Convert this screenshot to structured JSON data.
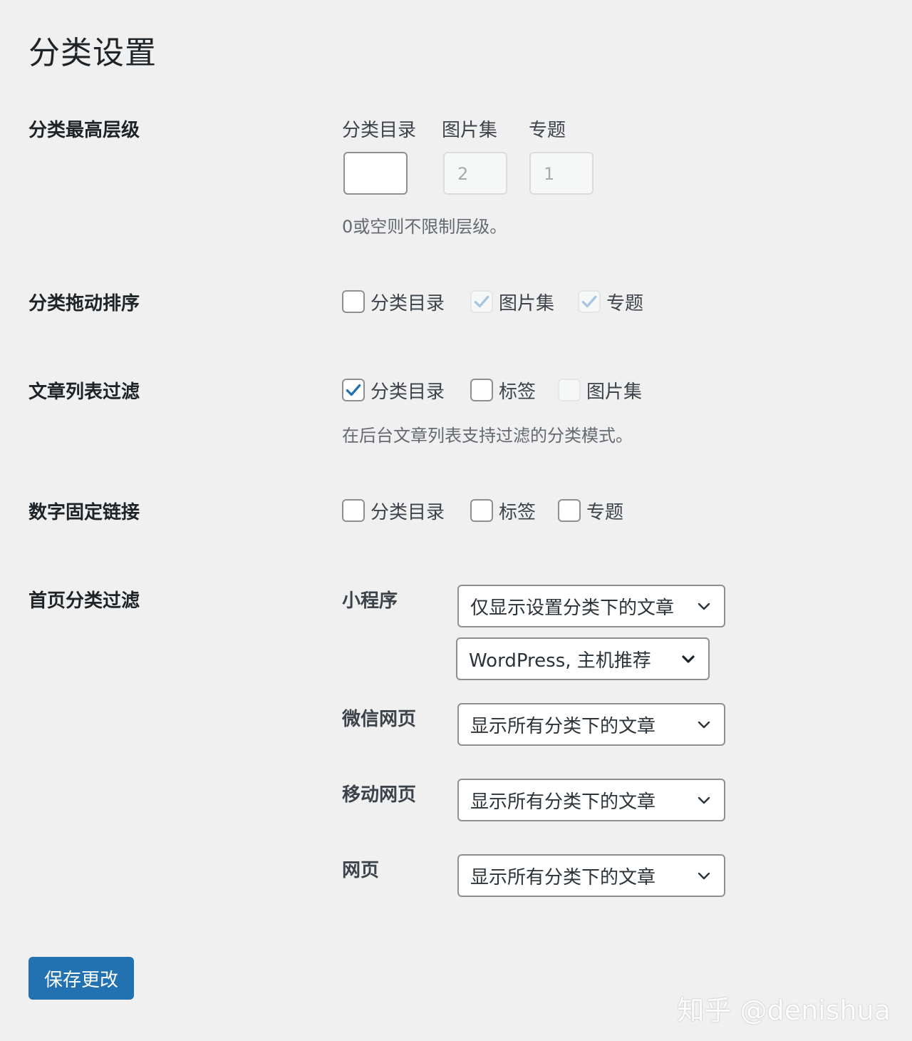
{
  "page": {
    "title": "分类设置"
  },
  "max_level": {
    "label": "分类最高层级",
    "columns": [
      {
        "heading": "分类目录",
        "value": "",
        "disabled": false
      },
      {
        "heading": "图片集",
        "value": "2",
        "disabled": true
      },
      {
        "heading": "专题",
        "value": "1",
        "disabled": true
      }
    ],
    "description": "0或空则不限制层级。"
  },
  "drag_sort": {
    "label": "分类拖动排序",
    "options": [
      {
        "label": "分类目录",
        "checked": false,
        "disabled": false
      },
      {
        "label": "图片集",
        "checked": true,
        "disabled": true
      },
      {
        "label": "专题",
        "checked": true,
        "disabled": true
      }
    ]
  },
  "list_filter": {
    "label": "文章列表过滤",
    "options": [
      {
        "label": "分类目录",
        "checked": true,
        "disabled": false
      },
      {
        "label": "标签",
        "checked": false,
        "disabled": false
      },
      {
        "label": "图片集",
        "checked": false,
        "disabled": true
      }
    ],
    "description": "在后台文章列表支持过滤的分类模式。"
  },
  "numeric_permalink": {
    "label": "数字固定链接",
    "options": [
      {
        "label": "分类目录",
        "checked": false,
        "disabled": false
      },
      {
        "label": "标签",
        "checked": false,
        "disabled": false
      },
      {
        "label": "专题",
        "checked": false,
        "disabled": false
      }
    ]
  },
  "home_filter": {
    "label": "首页分类过滤",
    "miniprogram": {
      "label": "小程序",
      "select": "仅显示设置分类下的文章",
      "categories": "WordPress, 主机推荐"
    },
    "wechat": {
      "label": "微信网页",
      "select": "显示所有分类下的文章"
    },
    "mobile": {
      "label": "移动网页",
      "select": "显示所有分类下的文章"
    },
    "web": {
      "label": "网页",
      "select": "显示所有分类下的文章"
    }
  },
  "save_button": {
    "label": "保存更改"
  },
  "watermark": {
    "text": "知乎 @denishua"
  },
  "colors": {
    "accent": "#2271b1",
    "background": "#f0f0f1",
    "check": "#2271b1",
    "check_disabled": "#a7c4e0"
  },
  "icons": {
    "check": "check-icon",
    "chevron": "chevron-down-icon"
  }
}
